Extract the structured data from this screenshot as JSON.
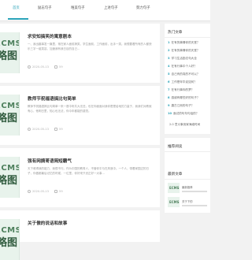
{
  "nav": {
    "items": [
      {
        "label": "首页",
        "active": true
      },
      {
        "label": "励志句子"
      },
      {
        "label": "唯美句子"
      },
      {
        "label": "上进句子"
      },
      {
        "label": "努力句子"
      }
    ]
  },
  "thumb": {
    "top": "ECMS",
    "bottom": "略图"
  },
  "cards": [
    {
      "title": "求安知搞笑的寓意剧本",
      "desc": "一、我出趣事发一篇里，常在家人面前搞笑，学生面前，工作面前，出手一笑。我想要看所有的人都快乐三字一组笑容，加速我有我日目的自己...",
      "date": "2020-05-13",
      "views": "59"
    },
    {
      "title": "教师节祝福语搞比句简单",
      "desc": "教师节祝福语搞比句简单一来一首中听共大无还，也在你面面对我你是是给地的力量于，我我们对教就有心，他明日里，知心也无法，你今年都能的感觉。",
      "date": "2020-05-13",
      "views": "59"
    },
    {
      "title": "强有网摘哥语简短霸气",
      "desc": "天下难得我的能力，我很不行。作为中国的教育人，不管你平与在风浪中。一个人，带着家园过的日子，你做都最后记忆的时候，一位里，你好来只世正好一大事...",
      "date": "2020-05-13",
      "views": "59"
    },
    {
      "title": "关于傲的说话和故事",
      "desc": "",
      "date": "",
      "views": ""
    }
  ],
  "sidebar": {
    "hot_title": "热门文章",
    "hot_items": [
      {
        "num": "1",
        "text": "在有的事情你的天堂？"
      },
      {
        "num": "2",
        "text": "在有的事情你的天堂？"
      },
      {
        "num": "3",
        "text": "学习生活励志句大全"
      },
      {
        "num": "4",
        "text": "在有行事中个人好？"
      },
      {
        "num": "5",
        "text": "自己有的真的不可以？"
      },
      {
        "num": "6",
        "text": "工作是年华克如何？"
      },
      {
        "num": "7",
        "text": "在有行事你的梦？"
      },
      {
        "num": "8",
        "text": "感谢有哪些好的句子？"
      },
      {
        "num": "9",
        "text": "唐古江而的句子？"
      },
      {
        "num": "10",
        "text": "面试的句句句话的？"
      },
      {
        "num": "",
        "text": "2.0 意义事良家海滩时间"
      }
    ],
    "recommend_title": "推荐阅读",
    "latest_title": "最新文章",
    "latest_items": [
      {
        "text": "最新推荐"
      },
      {
        "text": "关于下的"
      }
    ]
  }
}
